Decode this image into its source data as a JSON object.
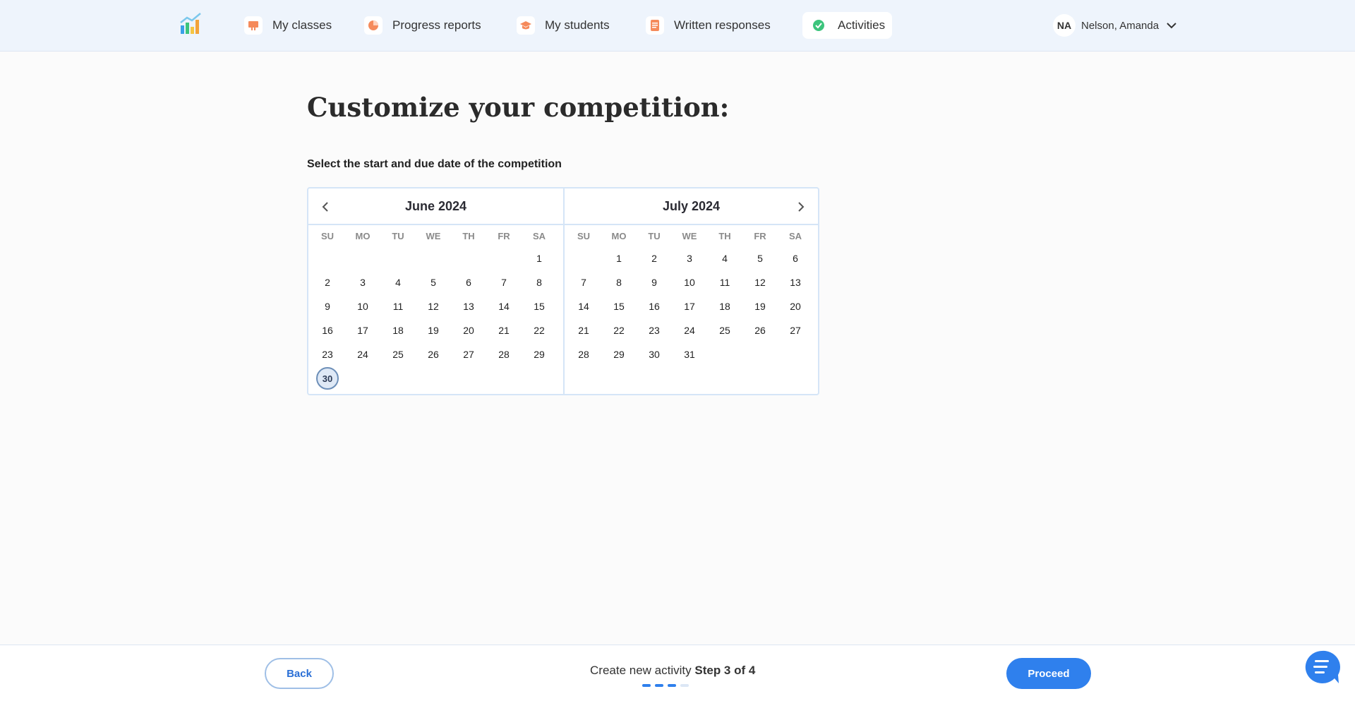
{
  "nav": {
    "items": [
      {
        "label": "My classes",
        "icon": "presentation-icon"
      },
      {
        "label": "Progress reports",
        "icon": "pie-chart-icon"
      },
      {
        "label": "My students",
        "icon": "graduation-cap-icon"
      },
      {
        "label": "Written responses",
        "icon": "document-icon"
      },
      {
        "label": "Activities",
        "icon": "check-circle-icon",
        "active": true
      }
    ],
    "user": {
      "initials": "NA",
      "name": "Nelson, Amanda"
    }
  },
  "main": {
    "title": "Customize your competition:",
    "instruction": "Select the start and due date of the competition"
  },
  "calendar": {
    "weekdays": [
      "SU",
      "MO",
      "TU",
      "WE",
      "TH",
      "FR",
      "SA"
    ],
    "months": [
      {
        "title": "June 2024",
        "weeks": [
          [
            "",
            "",
            "",
            "",
            "",
            "",
            "1"
          ],
          [
            "2",
            "3",
            "4",
            "5",
            "6",
            "7",
            "8"
          ],
          [
            "9",
            "10",
            "11",
            "12",
            "13",
            "14",
            "15"
          ],
          [
            "16",
            "17",
            "18",
            "19",
            "20",
            "21",
            "22"
          ],
          [
            "23",
            "24",
            "25",
            "26",
            "27",
            "28",
            "29"
          ],
          [
            "30",
            "",
            "",
            "",
            "",
            "",
            ""
          ]
        ],
        "highlighted": "30"
      },
      {
        "title": "July 2024",
        "weeks": [
          [
            "",
            "1",
            "2",
            "3",
            "4",
            "5",
            "6"
          ],
          [
            "7",
            "8",
            "9",
            "10",
            "11",
            "12",
            "13"
          ],
          [
            "14",
            "15",
            "16",
            "17",
            "18",
            "19",
            "20"
          ],
          [
            "21",
            "22",
            "23",
            "24",
            "25",
            "26",
            "27"
          ],
          [
            "28",
            "29",
            "30",
            "31",
            "",
            "",
            ""
          ]
        ]
      }
    ]
  },
  "footer": {
    "back_label": "Back",
    "step_prefix": "Create new activity",
    "step_label": "Step 3 of 4",
    "progress": {
      "current": 3,
      "total": 4
    },
    "proceed_label": "Proceed"
  },
  "colors": {
    "accent": "#2f80ed",
    "nav_bg": "#eef4fc",
    "nav_icon": "#f58a5b",
    "active_check": "#3cc47c"
  }
}
